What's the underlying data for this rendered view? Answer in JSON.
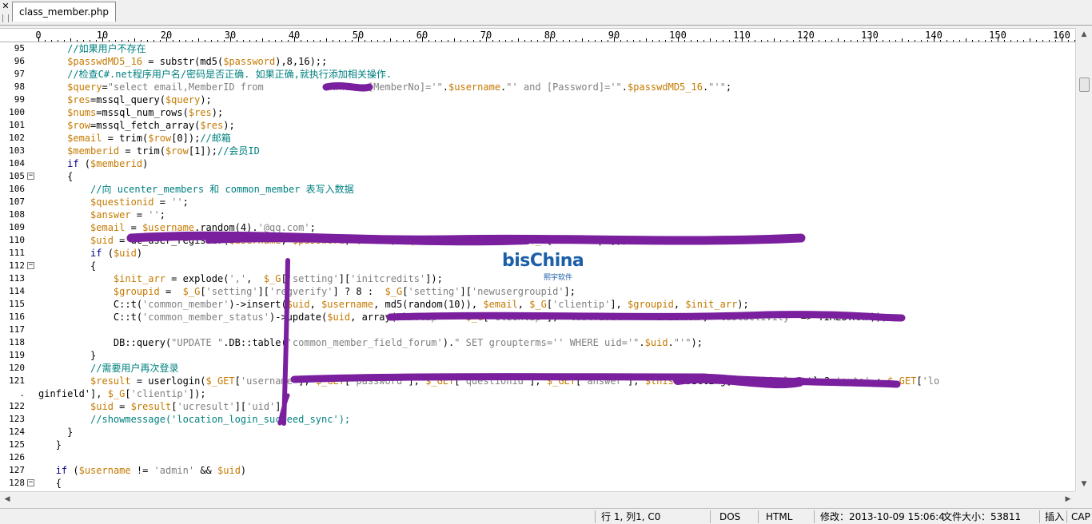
{
  "tab": {
    "filename": "class_member.php"
  },
  "ruler": {
    "labels": [
      "0",
      "10",
      "20",
      "30",
      "40",
      "50",
      "60",
      "70",
      "80",
      "90",
      "100",
      "110",
      "120",
      "130",
      "140",
      "150",
      "160"
    ]
  },
  "lines": [
    {
      "n": "95",
      "fold": false,
      "indent": 5,
      "parts": [
        [
          "c",
          "//如果用户不存在"
        ]
      ]
    },
    {
      "n": "96",
      "fold": false,
      "indent": 5,
      "parts": [
        [
          "v",
          "$passwdMD5_16"
        ],
        [
          "p",
          " = substr(md5("
        ],
        [
          "v",
          "$password"
        ],
        [
          "p",
          "),8,16);;"
        ]
      ]
    },
    {
      "n": "97",
      "fold": false,
      "indent": 5,
      "parts": [
        [
          "c",
          "//检查C#.net程序用户名/密码是否正确. 如果正确,就执行添加相关操作."
        ]
      ]
    },
    {
      "n": "98",
      "fold": false,
      "indent": 5,
      "parts": [
        [
          "v",
          "$query"
        ],
        [
          "p",
          "="
        ],
        [
          "s",
          "\"select email,MemberID from "
        ],
        [
          "s",
          "           "
        ],
        [
          "s",
          "where [MemberNo]='\""
        ],
        [
          "p",
          "."
        ],
        [
          "v",
          "$username"
        ],
        [
          "p",
          "."
        ],
        [
          "s",
          "\"' and [Password]='\""
        ],
        [
          "p",
          "."
        ],
        [
          "v",
          "$passwdMD5_16"
        ],
        [
          "p",
          "."
        ],
        [
          "s",
          "\"'\""
        ],
        [
          "p",
          ";"
        ]
      ]
    },
    {
      "n": "99",
      "fold": false,
      "indent": 5,
      "parts": [
        [
          "v",
          "$res"
        ],
        [
          "p",
          "=mssql_query("
        ],
        [
          "v",
          "$query"
        ],
        [
          "p",
          ");"
        ]
      ]
    },
    {
      "n": "100",
      "fold": false,
      "indent": 5,
      "parts": [
        [
          "v",
          "$nums"
        ],
        [
          "p",
          "=mssql_num_rows("
        ],
        [
          "v",
          "$res"
        ],
        [
          "p",
          ");"
        ]
      ]
    },
    {
      "n": "101",
      "fold": false,
      "indent": 5,
      "parts": [
        [
          "v",
          "$row"
        ],
        [
          "p",
          "=mssql_fetch_array("
        ],
        [
          "v",
          "$res"
        ],
        [
          "p",
          ");"
        ]
      ]
    },
    {
      "n": "102",
      "fold": false,
      "indent": 5,
      "parts": [
        [
          "v",
          "$email"
        ],
        [
          "p",
          " = trim("
        ],
        [
          "v",
          "$row"
        ],
        [
          "p",
          "[0]);"
        ],
        [
          "c",
          "//邮箱"
        ]
      ]
    },
    {
      "n": "103",
      "fold": false,
      "indent": 5,
      "parts": [
        [
          "v",
          "$memberid"
        ],
        [
          "p",
          " = trim("
        ],
        [
          "v",
          "$row"
        ],
        [
          "p",
          "[1]);"
        ],
        [
          "c",
          "//会员ID"
        ]
      ]
    },
    {
      "n": "104",
      "fold": false,
      "indent": 5,
      "parts": [
        [
          "k",
          "if"
        ],
        [
          "p",
          " ("
        ],
        [
          "v",
          "$memberid"
        ],
        [
          "p",
          ")"
        ]
      ]
    },
    {
      "n": "105",
      "fold": true,
      "indent": 5,
      "parts": [
        [
          "p",
          "{"
        ]
      ]
    },
    {
      "n": "106",
      "fold": false,
      "indent": 9,
      "parts": [
        [
          "c",
          "//向 ucenter_members 和 common_member 表写入数据"
        ]
      ]
    },
    {
      "n": "107",
      "fold": false,
      "indent": 9,
      "parts": [
        [
          "v",
          "$questionid"
        ],
        [
          "p",
          " = "
        ],
        [
          "s",
          "''"
        ],
        [
          "p",
          ";"
        ]
      ]
    },
    {
      "n": "108",
      "fold": false,
      "indent": 9,
      "parts": [
        [
          "v",
          "$answer"
        ],
        [
          "p",
          " = "
        ],
        [
          "s",
          "''"
        ],
        [
          "p",
          ";"
        ]
      ]
    },
    {
      "n": "109",
      "fold": false,
      "indent": 9,
      "parts": [
        [
          "v",
          "$email"
        ],
        [
          "p",
          " = "
        ],
        [
          "v",
          "$username"
        ],
        [
          "p",
          ".random(4)."
        ],
        [
          "s",
          "'@qq.com'"
        ],
        [
          "p",
          ";"
        ]
      ]
    },
    {
      "n": "110",
      "fold": false,
      "indent": 9,
      "parts": [
        [
          "v",
          "$uid"
        ],
        [
          "p",
          " = uc_user_register("
        ],
        [
          "v",
          "$username"
        ],
        [
          "p",
          ", "
        ],
        [
          "v",
          "$password"
        ],
        [
          "p",
          ", "
        ],
        [
          "v",
          "$email"
        ],
        [
          "p",
          ", "
        ],
        [
          "v",
          "$questionid"
        ],
        [
          "p",
          ", "
        ],
        [
          "v",
          "$answer"
        ],
        [
          "p",
          ", "
        ],
        [
          "v",
          "$_G"
        ],
        [
          "p",
          "['clientip']);"
        ]
      ]
    },
    {
      "n": "111",
      "fold": false,
      "indent": 9,
      "parts": [
        [
          "k",
          "if"
        ],
        [
          "p",
          " ("
        ],
        [
          "v",
          "$uid"
        ],
        [
          "p",
          ")"
        ]
      ]
    },
    {
      "n": "112",
      "fold": true,
      "indent": 9,
      "parts": [
        [
          "p",
          "{"
        ]
      ]
    },
    {
      "n": "113",
      "fold": false,
      "indent": 13,
      "parts": [
        [
          "v",
          "$init_arr"
        ],
        [
          "p",
          " = explode("
        ],
        [
          "s",
          "','"
        ],
        [
          "p",
          ",  "
        ],
        [
          "v",
          "$_G"
        ],
        [
          "p",
          "["
        ],
        [
          "s",
          "'setting'"
        ],
        [
          "p",
          "]["
        ],
        [
          "s",
          "'initcredits'"
        ],
        [
          "p",
          "]);"
        ]
      ]
    },
    {
      "n": "114",
      "fold": false,
      "indent": 13,
      "parts": [
        [
          "v",
          "$groupid"
        ],
        [
          "p",
          " =  "
        ],
        [
          "v",
          "$_G"
        ],
        [
          "p",
          "["
        ],
        [
          "s",
          "'setting'"
        ],
        [
          "p",
          "]["
        ],
        [
          "s",
          "'regverify'"
        ],
        [
          "p",
          "] ? 8 :  "
        ],
        [
          "v",
          "$_G"
        ],
        [
          "p",
          "["
        ],
        [
          "s",
          "'setting'"
        ],
        [
          "p",
          "]["
        ],
        [
          "s",
          "'newusergroupid'"
        ],
        [
          "p",
          "];"
        ]
      ]
    },
    {
      "n": "115",
      "fold": false,
      "indent": 13,
      "parts": [
        [
          "p",
          "C::t("
        ],
        [
          "s",
          "'common_member'"
        ],
        [
          "p",
          ")->insert("
        ],
        [
          "v",
          "$uid"
        ],
        [
          "p",
          ", "
        ],
        [
          "v",
          "$username"
        ],
        [
          "p",
          ", md5(random(10)), "
        ],
        [
          "v",
          "$email"
        ],
        [
          "p",
          ", "
        ],
        [
          "v",
          "$_G"
        ],
        [
          "p",
          "["
        ],
        [
          "s",
          "'clientip'"
        ],
        [
          "p",
          "], "
        ],
        [
          "v",
          "$groupid"
        ],
        [
          "p",
          ", "
        ],
        [
          "v",
          "$init_arr"
        ],
        [
          "p",
          ");"
        ]
      ]
    },
    {
      "n": "116",
      "fold": false,
      "indent": 13,
      "parts": [
        [
          "p",
          "C::t("
        ],
        [
          "s",
          "'common_member_status'"
        ],
        [
          "p",
          ")->update("
        ],
        [
          "v",
          "$uid"
        ],
        [
          "p",
          ", array("
        ],
        [
          "s",
          "'lastip'"
        ],
        [
          "p",
          " => "
        ],
        [
          "v",
          "$_G"
        ],
        [
          "p",
          "["
        ],
        [
          "s",
          "'clientip'"
        ],
        [
          "p",
          "], "
        ],
        [
          "s",
          "'lastvisit'"
        ],
        [
          "p",
          " => TIMESTAMP, "
        ],
        [
          "s",
          "'lastactivity'"
        ],
        [
          "p",
          " => TIMESTAMP));"
        ]
      ]
    },
    {
      "n": "117",
      "fold": false,
      "indent": 13,
      "parts": []
    },
    {
      "n": "118",
      "fold": false,
      "indent": 13,
      "parts": [
        [
          "p",
          "DB::query("
        ],
        [
          "s",
          "\"UPDATE \""
        ],
        [
          "p",
          ".DB::table("
        ],
        [
          "s",
          "'common_member_field_forum'"
        ],
        [
          "p",
          ")."
        ],
        [
          "s",
          "\" SET groupterms='' WHERE uid='\""
        ],
        [
          "p",
          "."
        ],
        [
          "v",
          "$uid"
        ],
        [
          "p",
          "."
        ],
        [
          "s",
          "\"'\""
        ],
        [
          "p",
          ");"
        ]
      ]
    },
    {
      "n": "119",
      "fold": false,
      "indent": 9,
      "parts": [
        [
          "p",
          "}"
        ]
      ]
    },
    {
      "n": "120",
      "fold": false,
      "indent": 9,
      "parts": [
        [
          "c",
          "//需要用户再次登录"
        ]
      ]
    },
    {
      "n": "121",
      "fold": false,
      "indent": 9,
      "parts": [
        [
          "v",
          "$result"
        ],
        [
          "p",
          " = userlogin("
        ],
        [
          "v",
          "$_GET"
        ],
        [
          "p",
          "["
        ],
        [
          "s",
          "'username'"
        ],
        [
          "p",
          "], "
        ],
        [
          "v",
          "$_GET"
        ],
        [
          "p",
          "["
        ],
        [
          "s",
          "'password'"
        ],
        [
          "p",
          "], "
        ],
        [
          "v",
          "$_GET"
        ],
        [
          "p",
          "["
        ],
        [
          "s",
          "'questionid'"
        ],
        [
          "p",
          "], "
        ],
        [
          "v",
          "$_GET"
        ],
        [
          "p",
          "["
        ],
        [
          "s",
          "'answer'"
        ],
        [
          "p",
          "], "
        ],
        [
          "v",
          "$this"
        ],
        [
          "p",
          "->setting["
        ],
        [
          "s",
          "'autoidselect'"
        ],
        [
          "p",
          "] ? "
        ],
        [
          "s",
          "'auto'"
        ],
        [
          "p",
          " : "
        ],
        [
          "v",
          "$_GET"
        ],
        [
          "p",
          "["
        ],
        [
          "s",
          "'lo"
        ]
      ]
    },
    {
      "n": ".",
      "fold": false,
      "indent": 0,
      "parts": [
        [
          "p",
          "ginfield'], "
        ],
        [
          "v",
          "$_G"
        ],
        [
          "p",
          "["
        ],
        [
          "s",
          "'clientip'"
        ],
        [
          "p",
          "]);"
        ]
      ]
    },
    {
      "n": "122",
      "fold": false,
      "indent": 9,
      "parts": [
        [
          "v",
          "$uid"
        ],
        [
          "p",
          " = "
        ],
        [
          "v",
          "$result"
        ],
        [
          "p",
          "["
        ],
        [
          "s",
          "'ucresult'"
        ],
        [
          "p",
          "]["
        ],
        [
          "s",
          "'uid'"
        ],
        [
          "p",
          "];"
        ]
      ]
    },
    {
      "n": "123",
      "fold": false,
      "indent": 9,
      "parts": [
        [
          "c",
          "//showmessage('location_login_succeed_sync');"
        ]
      ]
    },
    {
      "n": "124",
      "fold": false,
      "indent": 5,
      "parts": [
        [
          "p",
          "}"
        ]
      ]
    },
    {
      "n": "125",
      "fold": false,
      "indent": 3,
      "parts": [
        [
          "p",
          "}"
        ]
      ]
    },
    {
      "n": "126",
      "fold": false,
      "indent": 0,
      "parts": []
    },
    {
      "n": "127",
      "fold": false,
      "indent": 3,
      "parts": [
        [
          "k",
          "if"
        ],
        [
          "p",
          " ("
        ],
        [
          "v",
          "$username"
        ],
        [
          "p",
          " != "
        ],
        [
          "s",
          "'admin'"
        ],
        [
          "p",
          " && "
        ],
        [
          "v",
          "$uid"
        ],
        [
          "p",
          ")"
        ]
      ]
    },
    {
      "n": "128",
      "fold": true,
      "indent": 3,
      "parts": [
        [
          "p",
          "{"
        ]
      ]
    }
  ],
  "watermark": {
    "brand": "bisChina",
    "sub": "熙宇软件"
  },
  "status": {
    "position": "行 1, 列1, C0",
    "eol": "DOS",
    "syntax": "HTML",
    "modified": "修改：2013-10-09 15:06:4",
    "filesize": "文件大小：53811",
    "insert": "插入",
    "caps": "CAP"
  },
  "colors": {
    "comment": "#008080",
    "variable": "#c47a00",
    "string": "#808080",
    "keyword": "#000080",
    "scribble": "#7a1f9e"
  },
  "icons": {
    "close": "close-icon",
    "fold": "fold-minus-icon"
  }
}
